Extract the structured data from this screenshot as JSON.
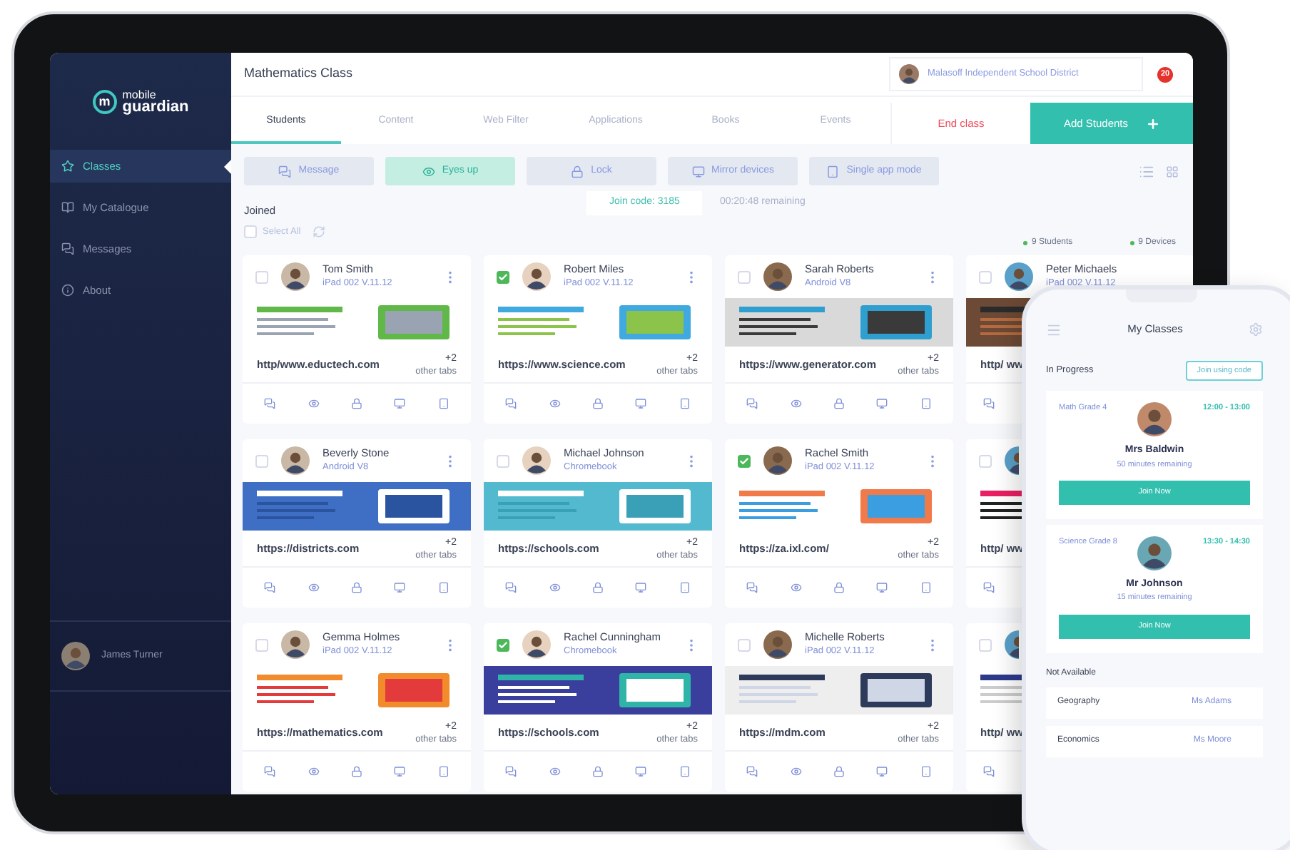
{
  "logo": {
    "badge": "m",
    "line1": "mobile",
    "line2": "guardian"
  },
  "sidebar": {
    "items": [
      {
        "label": "Classes",
        "selected": true
      },
      {
        "label": "My Catalogue",
        "selected": false
      },
      {
        "label": "Messages",
        "selected": false
      },
      {
        "label": "About",
        "selected": false
      }
    ],
    "user": "James Turner"
  },
  "header": {
    "title": "Mathematics Class",
    "district": "Malasoff Independent School District",
    "notifications": "20"
  },
  "tabs": [
    {
      "label": "Students",
      "selected": true
    },
    {
      "label": "Content",
      "selected": false
    },
    {
      "label": "Web Filter",
      "selected": false
    },
    {
      "label": "Applications",
      "selected": false
    },
    {
      "label": "Books",
      "selected": false
    },
    {
      "label": "Events",
      "selected": false
    }
  ],
  "end_class": "End class",
  "add_students": "Add Students",
  "toolbar": [
    {
      "label": "Message",
      "selected": false
    },
    {
      "label": "Eyes up",
      "selected": true
    },
    {
      "label": "Lock",
      "selected": false
    },
    {
      "label": "Mirror devices",
      "selected": false
    },
    {
      "label": "Single app mode",
      "selected": false
    }
  ],
  "joined": {
    "title": "Joined",
    "select_all": "Select All",
    "select_all_checked": false,
    "join_code": "Join code: 3185",
    "remaining": "00:20:48 remaining",
    "students": "9 Students",
    "devices": "9 Devices"
  },
  "cards": [
    {
      "kind": "full",
      "name": "Tom Smith",
      "device": "iPad 002 V.11.12",
      "checked": false,
      "url": "http/www.eductech.com",
      "extra": "+2",
      "extra_label": "other tabs"
    },
    {
      "kind": "full",
      "name": "Robert Miles",
      "device": "iPad 002 V.11.12",
      "checked": true,
      "url": "https://www.science.com",
      "extra": "+2",
      "extra_label": "other tabs"
    },
    {
      "kind": "full",
      "name": "Sarah Roberts",
      "device": "Android V8",
      "checked": false,
      "url": "https://www.generator.com",
      "extra": "+2",
      "extra_label": "other tabs"
    },
    {
      "kind": "cut",
      "name": "Peter Michaels",
      "device": "iPad 002 V.11.12",
      "checked": false,
      "url": "http/ ww"
    },
    {
      "kind": "full",
      "name": "Beverly Stone",
      "device": "Android V8",
      "checked": false,
      "url": "https://districts.com",
      "extra": "+2",
      "extra_label": "other tabs"
    },
    {
      "kind": "full",
      "name": "Michael Johnson",
      "device": "Chromebook",
      "checked": false,
      "url": "https://schools.com",
      "extra": "+2",
      "extra_label": "other tabs"
    },
    {
      "kind": "full",
      "name": "Rachel Smith",
      "device": "iPad 002 V.11.12",
      "checked": true,
      "url": "https://za.ixl.com/",
      "extra": "+2",
      "extra_label": "other tabs"
    },
    {
      "kind": "cut",
      "checked": false,
      "url": "http/ ww"
    },
    {
      "kind": "full",
      "name": "Gemma Holmes",
      "device": "iPad 002 V.11.12",
      "checked": false,
      "url": "https://mathematics.com",
      "extra": "+2",
      "extra_label": "other tabs"
    },
    {
      "kind": "full",
      "name": "Rachel Cunningham",
      "device": "Chromebook",
      "checked": true,
      "url": "https://schools.com",
      "extra": "+2",
      "extra_label": "other tabs"
    },
    {
      "kind": "full",
      "name": "Michelle Roberts",
      "device": "iPad 002 V.11.12",
      "checked": false,
      "url": "https://mdm.com",
      "extra": "+2",
      "extra_label": "other tabs"
    },
    {
      "kind": "cut",
      "checked": false,
      "url": "http/ ww"
    }
  ],
  "phone": {
    "title": "My Classes",
    "in_progress": "In Progress",
    "join_code": "Join using code",
    "classes": [
      {
        "subject": "Math Grade 4",
        "time": "12:00 - 13:00",
        "teacher": "Mrs Baldwin",
        "remaining": "50 minutes remaining",
        "button": "Join Now"
      },
      {
        "subject": "Science Grade 8",
        "time": "13:30 - 14:30",
        "teacher": "Mr Johnson",
        "remaining": "15 minutes remaining",
        "button": "Join Now"
      }
    ],
    "not_available": "Not Available",
    "unavailable": [
      {
        "subject": "Geography",
        "teacher": "Ms Adams"
      },
      {
        "subject": "Economics",
        "teacher": "Ms Moore"
      }
    ]
  }
}
